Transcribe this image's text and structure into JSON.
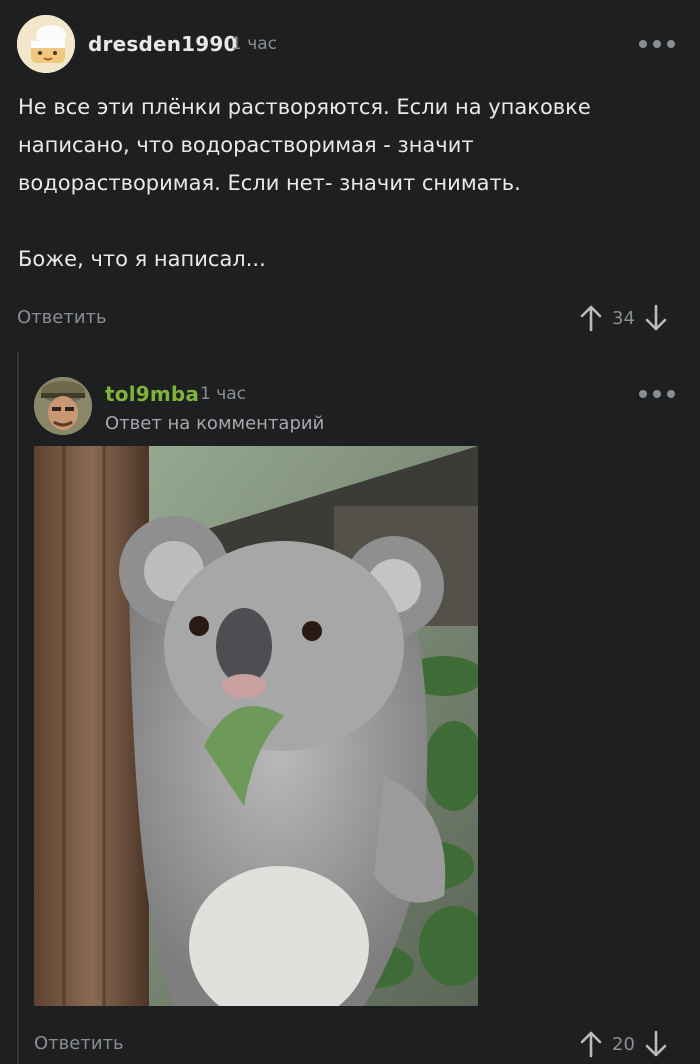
{
  "comments": [
    {
      "username": "dresden1990",
      "time": "1 час",
      "text": [
        "Не все эти плёнки растворяются. Если на упаковке написано, что водорастворимая - значит водорастворимая. Если нет- значит снимать.",
        "Боже, что я написал..."
      ],
      "reply_label": "Ответить",
      "rating": "34"
    },
    {
      "username": "tol9mba",
      "time": "1 час",
      "subtitle": "Ответ на комментарий",
      "reply_label": "Ответить",
      "rating": "20"
    }
  ],
  "colors": {
    "background": "#1d1f21",
    "username_green": "#7fb33b",
    "muted": "#8b8e91"
  }
}
